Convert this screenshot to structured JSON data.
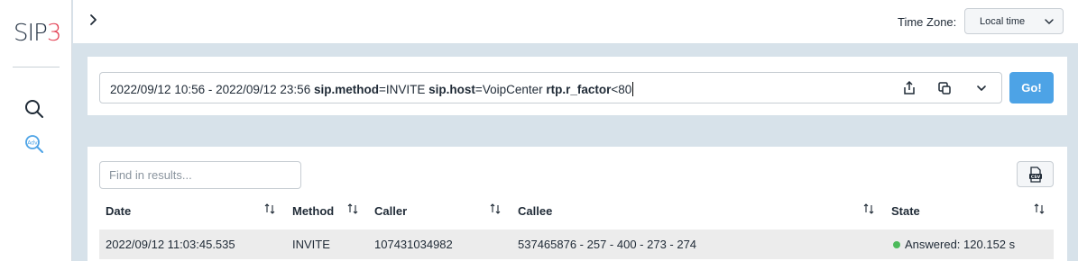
{
  "app": {
    "logo_part1": "SIP",
    "logo_part2": "3",
    "brand_color": "#e23b4f",
    "accent_color": "#4da3e6"
  },
  "sidebar": {
    "items": [
      {
        "name": "search",
        "icon": "search-icon"
      },
      {
        "name": "advanced-search",
        "icon": "adv-search-icon"
      }
    ]
  },
  "header": {
    "expand_icon": "chevron-right-icon",
    "timezone_label": "Time Zone:",
    "timezone_value": "Local time"
  },
  "query": {
    "date_range": "2022/09/12 10:56 - 2022/09/12 23:56",
    "filters": [
      {
        "key": "sip.method",
        "op": "=",
        "value": "INVITE"
      },
      {
        "key": "sip.host",
        "op": "=",
        "value": "VoipCenter"
      },
      {
        "key": "rtp.r_factor",
        "op": "<",
        "value": "80"
      }
    ],
    "icons": [
      "share-icon",
      "copy-icon",
      "chevron-down-icon"
    ],
    "go_label": "Go!"
  },
  "results": {
    "find_placeholder": "Find in results...",
    "export_icon": "csv-export-icon",
    "columns": [
      "Date",
      "Method",
      "Caller",
      "Callee",
      "State"
    ],
    "rows": [
      {
        "date": "2022/09/12 11:03:45.535",
        "method": "INVITE",
        "caller": "107431034982",
        "callee": "537465876 - 257 - 400 - 273 - 274",
        "state": "Answered: 120.152 s",
        "state_color": "#4cba5a"
      }
    ]
  }
}
